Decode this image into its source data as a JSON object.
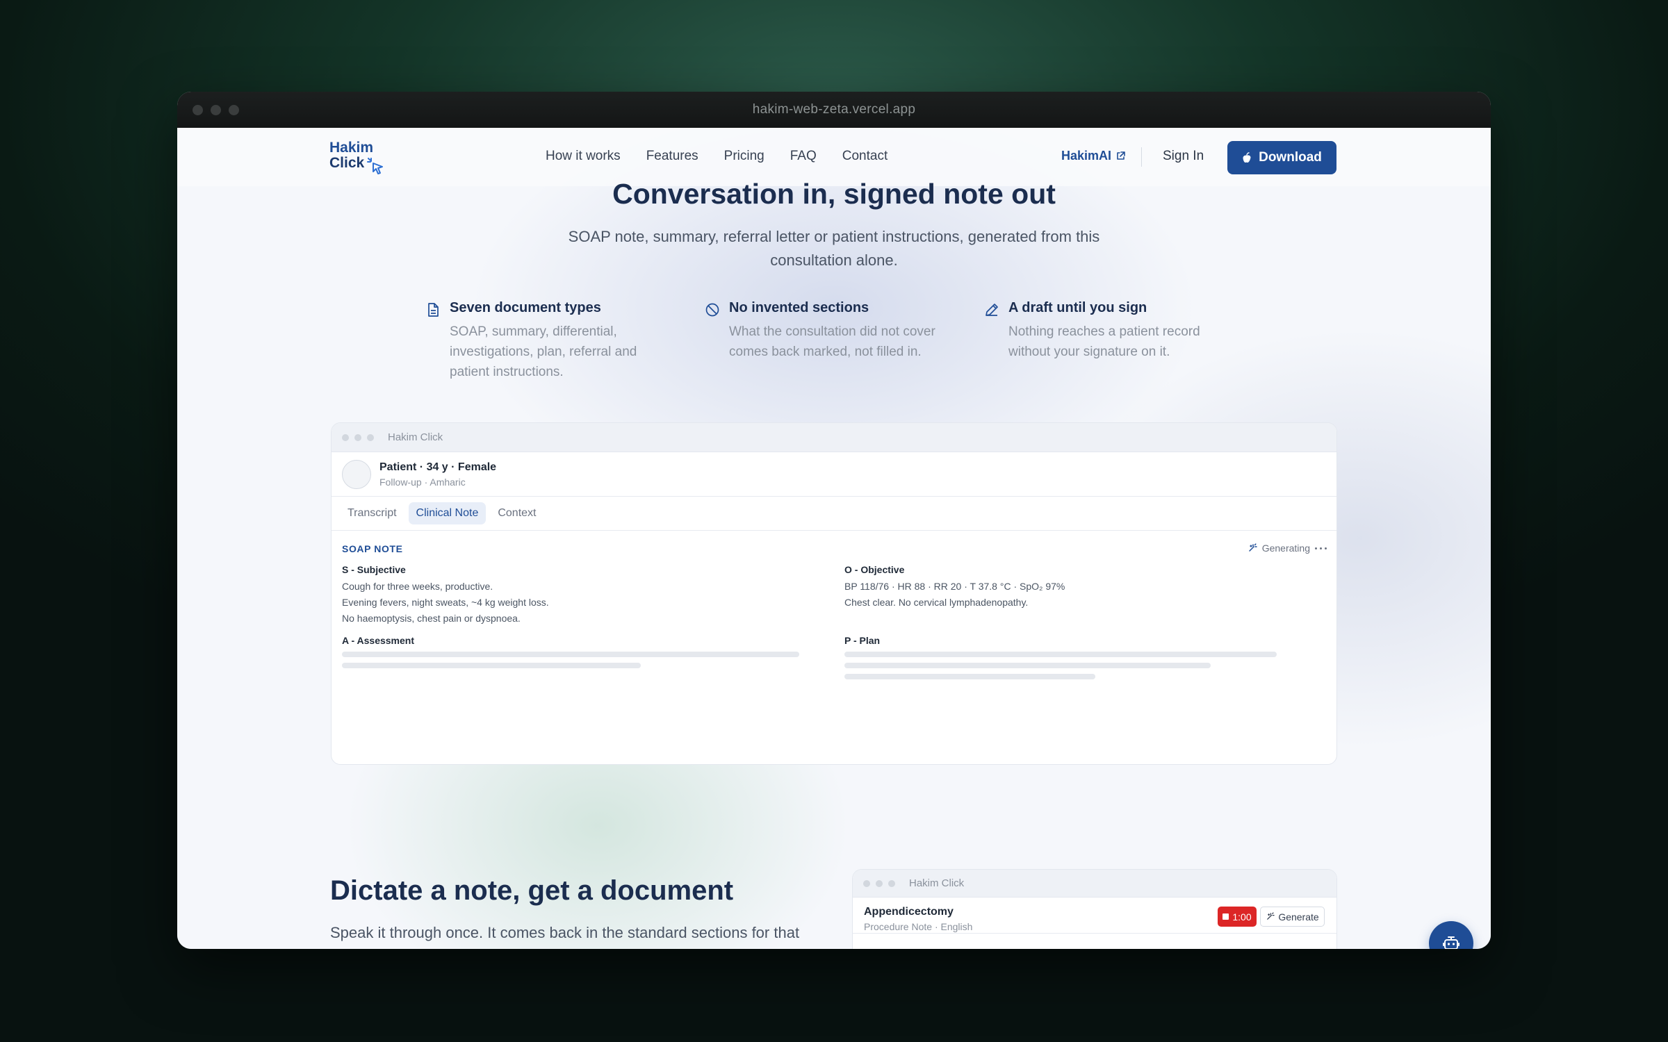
{
  "browser": {
    "url": "hakim-web-zeta.vercel.app"
  },
  "nav": {
    "logo_line1": "Hakim",
    "logo_line2": "Click",
    "links": [
      "How it works",
      "Features",
      "Pricing",
      "FAQ",
      "Contact"
    ],
    "hakimai": "HakimAI",
    "signin": "Sign In",
    "download": "Download"
  },
  "hero": {
    "title": "Conversation in, signed note out",
    "subtitle": "SOAP note, summary, referral letter or patient instructions, generated from this consultation alone."
  },
  "features": [
    {
      "icon": "document-icon",
      "title": "Seven document types",
      "text": "SOAP, summary, differential, investigations, plan, referral and patient instructions."
    },
    {
      "icon": "ban-icon",
      "title": "No invented sections",
      "text": "What the consultation did not cover comes back marked, not filled in."
    },
    {
      "icon": "pencil-icon",
      "title": "A draft until you sign",
      "text": "Nothing reaches a patient record without your signature on it."
    }
  ],
  "app": {
    "window_title": "Hakim Click",
    "patient_name": "Patient · 34 y · Female",
    "patient_sub": "Follow-up · Amharic",
    "tabs": [
      "Transcript",
      "Clinical Note",
      "Context"
    ],
    "active_tab": "Clinical Note",
    "note_header": "SOAP NOTE",
    "status": "Generating",
    "sections": {
      "s_title": "S - Subjective",
      "s_lines": [
        "Cough for three weeks, productive.",
        "Evening fevers, night sweats, ~4 kg weight loss.",
        "No haemoptysis, chest pain or dyspnoea."
      ],
      "o_title": "O - Objective",
      "o_lines": [
        "BP 118/76 · HR 88 · RR 20 · T 37.8 °C · SpO₂ 97%",
        "Chest clear. No cervical lymphadenopathy."
      ],
      "a_title": "A - Assessment",
      "p_title": "P - Plan"
    }
  },
  "dictate": {
    "title": "Dictate a note, get a document",
    "subtitle": "Speak it through once. It comes back in the standard sections for that"
  },
  "app2": {
    "window_title": "Hakim Click",
    "procedure": "Appendicectomy",
    "procedure_sub": "Procedure Note · English",
    "timer": "1:00",
    "generate": "Generate"
  },
  "colors": {
    "brand": "#1f4d96",
    "record": "#dc2626"
  }
}
